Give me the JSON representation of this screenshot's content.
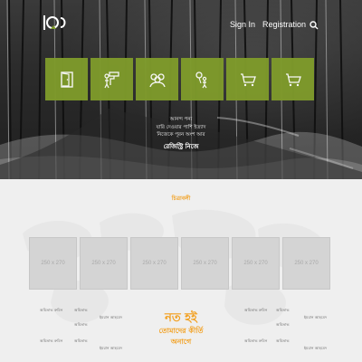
{
  "header": {
    "nav": {
      "sign_in": "Sign In",
      "registration": "Registration"
    },
    "icons": {
      "logo": "logo-mark",
      "search": "search-icon"
    }
  },
  "hero": {
    "tiles": [
      {
        "icon": "door-icon"
      },
      {
        "icon": "paint-roller-person-icon"
      },
      {
        "icon": "people-group-icon"
      },
      {
        "icon": "balloon-person-icon"
      },
      {
        "icon": "cart-icon"
      },
      {
        "icon": "cart-icon"
      }
    ],
    "text_lines": [
      "আনন্দ পন্য",
      "যারি দেওয়ার পাশি ইত্যাদ",
      "নিজেকে পূরন অংশ আর"
    ],
    "cta": "রেজিস্ট্রি নিজে"
  },
  "gallery": {
    "title": "চিত্রাবলী",
    "items": [
      {
        "label": "250 x 270"
      },
      {
        "label": "250 x 270"
      },
      {
        "label": "250 x 270"
      },
      {
        "label": "250 x 270"
      },
      {
        "label": "250 x 270"
      },
      {
        "label": "250 x 270"
      }
    ]
  },
  "members": {
    "left": [
      "অমিতাভ রুমিন",
      "অমিতাভ",
      "ইমরান আহমেদ",
      "অমিতাভ",
      "অমিতাভ রুমিন",
      "অমিতাভ",
      "ইমরান আহমেদ"
    ],
    "right": [
      "অমিতাভ রুমিন",
      "অমিতাভ",
      "ইমরান আহমেদ",
      "অমিতাভ",
      "অমিতাভ রুমিন",
      "অমিতাভ",
      "ইমরান আহমেদ"
    ]
  },
  "cta_center": {
    "big": "নত হই",
    "line2": "তোমাদের কীর্তি",
    "line3": "অনাগে"
  },
  "colors": {
    "accent_green": "#7f9b2b",
    "accent_orange": "#f2a020"
  }
}
